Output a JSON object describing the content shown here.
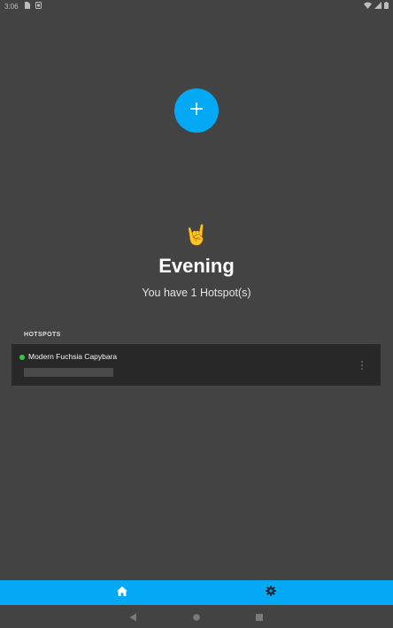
{
  "status_bar": {
    "time": "3:06",
    "icons": [
      "sim-card-icon",
      "notification-icon",
      "wifi-icon",
      "cellular-signal-icon",
      "battery-icon"
    ]
  },
  "fab": {
    "icon": "plus-icon",
    "color": "#03a9f4"
  },
  "greeting": {
    "emoji": "🤘",
    "title": "Evening",
    "subtitle": "You have 1 Hotspot(s)"
  },
  "hotspots": {
    "section_label": "HOTSPOTS",
    "items": [
      {
        "name": "Modern Fuchsia Capybara",
        "status_color": "#2ecc40",
        "menu_icon": "more-vertical-icon"
      }
    ]
  },
  "bottom_nav": {
    "items": [
      {
        "icon": "home-icon",
        "selected": true
      },
      {
        "icon": "settings-gear-icon",
        "selected": false
      }
    ],
    "color": "#03a9f4"
  },
  "system_nav": {
    "icons": [
      "back-icon",
      "home-circle-icon",
      "recents-icon"
    ]
  },
  "colors": {
    "background": "#434343",
    "card": "#282828",
    "accent": "#03a9f4",
    "online": "#2ecc40"
  }
}
